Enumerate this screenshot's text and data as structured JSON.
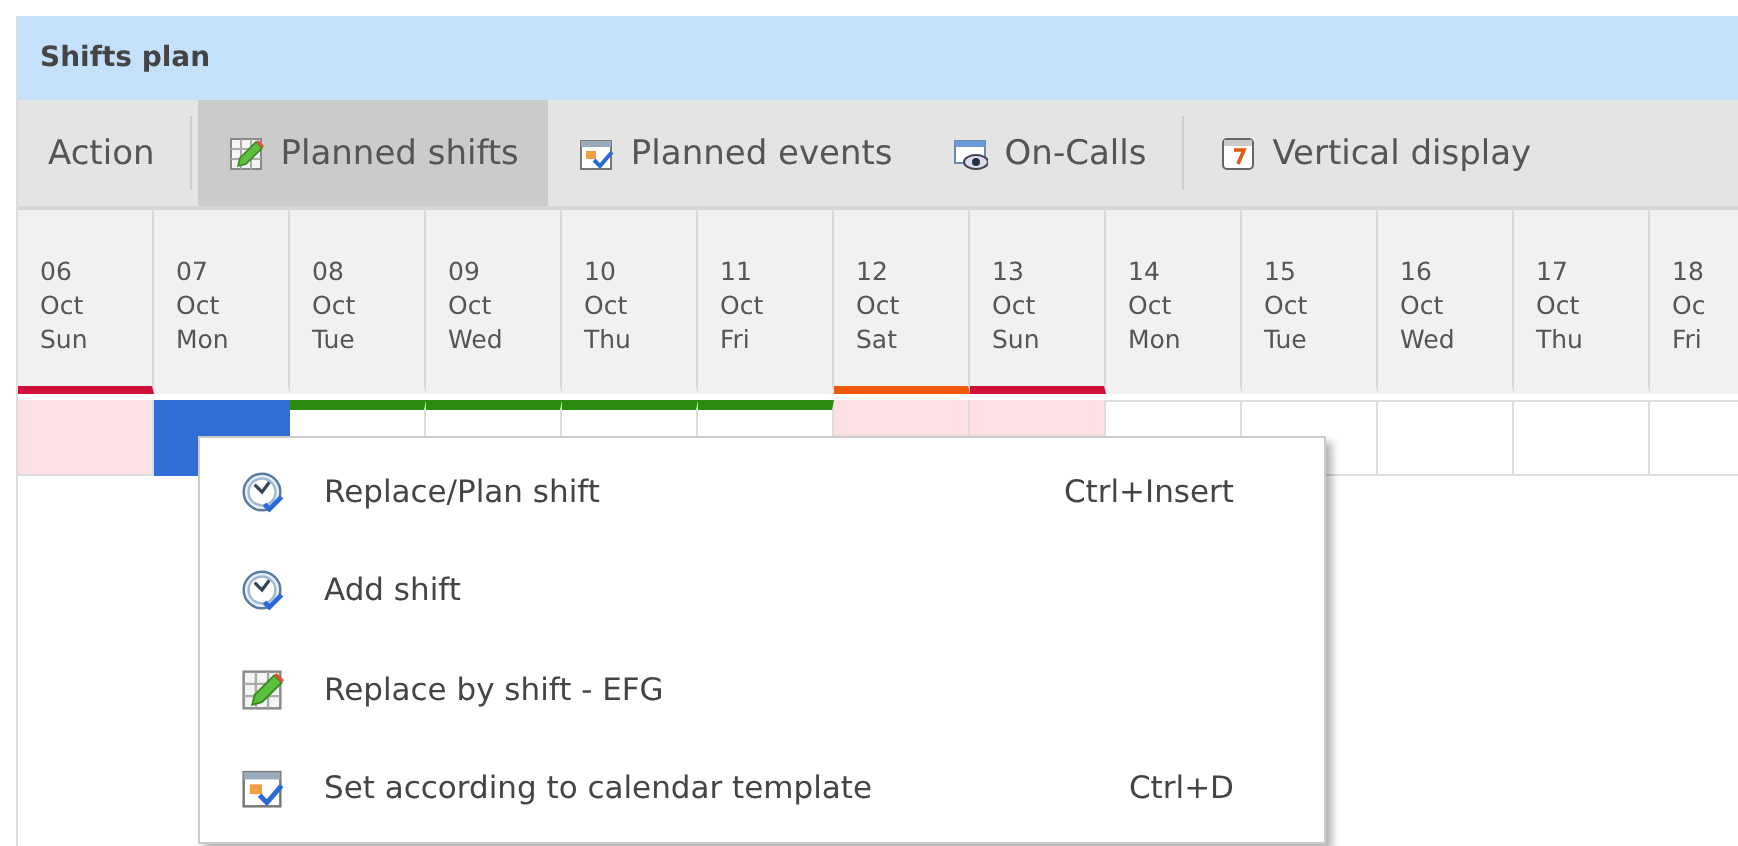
{
  "window": {
    "title": "Shifts plan"
  },
  "toolbar": [
    {
      "kind": "menu",
      "label": "Action",
      "selected": false
    },
    {
      "kind": "tab",
      "label": "Planned shifts",
      "selected": true
    },
    {
      "kind": "tab",
      "label": "Planned events",
      "selected": false
    },
    {
      "kind": "tab",
      "label": "On-Calls",
      "selected": false
    },
    {
      "kind": "tab",
      "label": "Vertical display",
      "selected": false
    }
  ],
  "days": [
    {
      "day": "06",
      "month": "Oct",
      "weekday": "Sun",
      "color": "#d0103a",
      "cell": {
        "kind": "weekend"
      }
    },
    {
      "day": "07",
      "month": "Oct",
      "weekday": "Mon",
      "cell": {
        "kind": "block",
        "color": "#2f6fd6"
      }
    },
    {
      "day": "08",
      "month": "Oct",
      "weekday": "Tue",
      "cell": {
        "kind": "strip",
        "color": "#2b8a10"
      }
    },
    {
      "day": "09",
      "month": "Oct",
      "weekday": "Wed",
      "cell": {
        "kind": "strip",
        "color": "#2b8a10"
      }
    },
    {
      "day": "10",
      "month": "Oct",
      "weekday": "Thu",
      "cell": {
        "kind": "strip",
        "color": "#2b8a10"
      }
    },
    {
      "day": "11",
      "month": "Oct",
      "weekday": "Fri",
      "cell": {
        "kind": "strip",
        "color": "#2b8a10"
      }
    },
    {
      "day": "12",
      "month": "Oct",
      "weekday": "Sat",
      "color": "#f05a0a",
      "cell": {
        "kind": "weekend"
      }
    },
    {
      "day": "13",
      "month": "Oct",
      "weekday": "Sun",
      "color": "#d0103a",
      "cell": {
        "kind": "weekend"
      }
    },
    {
      "day": "14",
      "month": "Oct",
      "weekday": "Mon",
      "cell": {
        "kind": "empty"
      }
    },
    {
      "day": "15",
      "month": "Oct",
      "weekday": "Tue",
      "cell": {
        "kind": "empty"
      }
    },
    {
      "day": "16",
      "month": "Oct",
      "weekday": "Wed",
      "cell": {
        "kind": "empty"
      }
    },
    {
      "day": "17",
      "month": "Oct",
      "weekday": "Thu",
      "cell": {
        "kind": "empty"
      }
    },
    {
      "day": "18",
      "month": "Oc",
      "weekday": "Fri",
      "cell": {
        "kind": "empty"
      }
    }
  ],
  "context_menu": [
    {
      "label": "Replace/Plan shift",
      "shortcut": "Ctrl+Insert"
    },
    {
      "label": "Add shift"
    },
    {
      "label": "Replace by shift - EFG"
    },
    {
      "label": "Set according to calendar template",
      "shortcut": "Ctrl+D"
    }
  ]
}
